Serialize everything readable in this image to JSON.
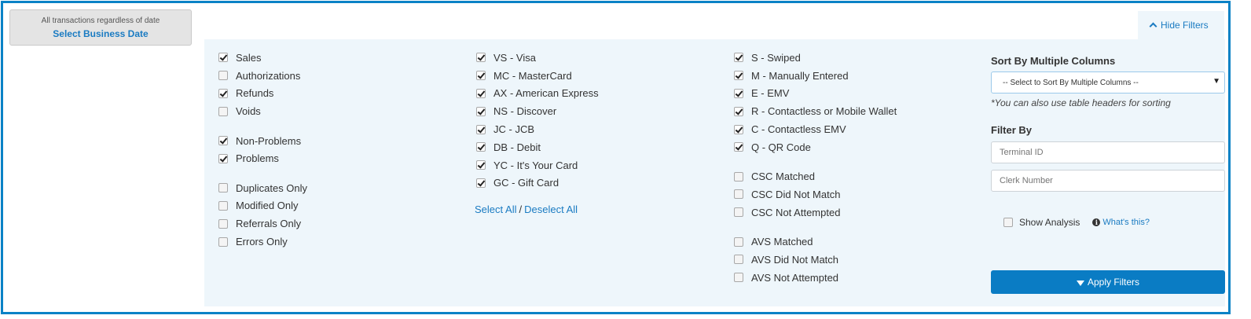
{
  "date_box": {
    "subtitle": "All transactions regardless of date",
    "link": "Select Business Date"
  },
  "hide_filters": {
    "label": "Hide Filters"
  },
  "transaction_types": [
    {
      "label": "Sales",
      "checked": true
    },
    {
      "label": "Authorizations",
      "checked": false
    },
    {
      "label": "Refunds",
      "checked": true
    },
    {
      "label": "Voids",
      "checked": false
    }
  ],
  "problem_filters": [
    {
      "label": "Non-Problems",
      "checked": true
    },
    {
      "label": "Problems",
      "checked": true
    }
  ],
  "only_filters": [
    {
      "label": "Duplicates Only",
      "checked": false
    },
    {
      "label": "Modified Only",
      "checked": false
    },
    {
      "label": "Referrals Only",
      "checked": false
    },
    {
      "label": "Errors Only",
      "checked": false
    }
  ],
  "card_types": [
    {
      "label": "VS - Visa",
      "checked": true
    },
    {
      "label": "MC - MasterCard",
      "checked": true
    },
    {
      "label": "AX - American Express",
      "checked": true
    },
    {
      "label": "NS - Discover",
      "checked": true
    },
    {
      "label": "JC - JCB",
      "checked": true
    },
    {
      "label": "DB - Debit",
      "checked": true
    },
    {
      "label": "YC - It's Your Card",
      "checked": true
    },
    {
      "label": "GC - Gift Card",
      "checked": true
    }
  ],
  "select_links": {
    "select_all": "Select All",
    "separator": "/",
    "deselect_all": "Deselect All"
  },
  "entry_modes": [
    {
      "label": "S - Swiped",
      "checked": true
    },
    {
      "label": "M - Manually Entered",
      "checked": true
    },
    {
      "label": "E - EMV",
      "checked": true
    },
    {
      "label": "R - Contactless or Mobile Wallet",
      "checked": true
    },
    {
      "label": "C - Contactless EMV",
      "checked": true
    },
    {
      "label": "Q - QR Code",
      "checked": true
    }
  ],
  "csc_filters": [
    {
      "label": "CSC Matched",
      "checked": false
    },
    {
      "label": "CSC Did Not Match",
      "checked": false
    },
    {
      "label": "CSC Not Attempted",
      "checked": false
    }
  ],
  "avs_filters": [
    {
      "label": "AVS Matched",
      "checked": false
    },
    {
      "label": "AVS Did Not Match",
      "checked": false
    },
    {
      "label": "AVS Not Attempted",
      "checked": false
    }
  ],
  "sort": {
    "label": "Sort By Multiple Columns",
    "selected": "-- Select to Sort By Multiple Columns --",
    "caret": "▼",
    "hint": "*You can also use table headers for sorting"
  },
  "filter_by": {
    "label": "Filter By",
    "terminal_placeholder": "Terminal ID",
    "clerk_placeholder": "Clerk Number"
  },
  "analysis": {
    "label": "Show Analysis",
    "checked": false,
    "help": "What's this?",
    "info_glyph": "i"
  },
  "apply": {
    "label": "Apply Filters"
  },
  "colors": {
    "accent": "#0a7cc4",
    "border": "#0a82c6",
    "panel": "#eef6fb",
    "link": "#1a7bc2"
  }
}
